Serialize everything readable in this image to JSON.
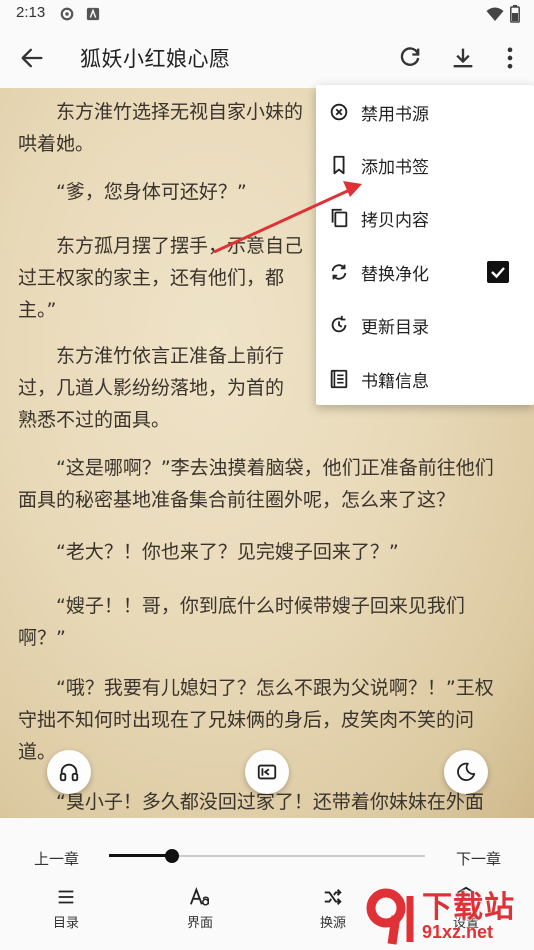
{
  "status": {
    "time": "2:13"
  },
  "appbar": {
    "title": "狐妖小红娘心愿"
  },
  "reader": {
    "paragraphs": [
      "　　东方淮竹选择无视自家小妹的存在，陪笑哄着她。",
      "　　“爹，您身体可还好？”",
      "　　东方孤月摆了摆手，示意自己无碍，又想起了过王权家的家主，还有他们，都是正道中的人士。”",
      "　　东方淮竹依言正准备上前行礼，一阵风吹过，几道人影纷纷落地，为首的人带着熟悉不过的面具。",
      "　　“这是哪啊？”李去浊摸着脑袋，他们正准备前往他们面具的秘密基地准备集合前往圈外呢，怎么来了这？",
      "　　“老大？！你也来了？见完嫂子回来了？”",
      "　　“嫂子！！哥，你到底什么时候带嫂子回来见我们啊？”",
      "　　“哦？我要有儿媳妇了？怎么不跟为父说啊？！”王权守拙不知何时出现在了兄妹俩的身后，皮笑肉不笑的问道。",
      "　　“臭小子！多久都没回过家了！还带着你妹妹在外面"
    ],
    "visible_lines": [
      [
        "　　东方淮竹选择无视自家小妹的",
        "哄着她。"
      ],
      [
        "　　“爹，您身体可还好？”"
      ],
      [
        "　　东方孤月摆了摆手，示意自己",
        "过王权家的家主，还有他们，都",
        "主。”"
      ],
      [
        "　　东方淮竹依言正准备上前行",
        "过，几道人影纷纷落地，为首的",
        "熟悉不过的面具。"
      ],
      [
        "　　“这是哪啊？”李去浊摸着脑袋，他们正准备前往他们",
        "面具的秘密基地准备集合前往圈外呢，怎么来了这？"
      ],
      [
        "　　“老大？！你也来了？见完嫂子回来了？”"
      ],
      [
        "　　“嫂子！！哥，你到底什么时候带嫂子回来见我们",
        "啊？”"
      ],
      [
        "　　“哦？我要有儿媳妇了？怎么不跟为父说啊？！”王权",
        "守拙不知何时出现在了兄妹俩的身后，皮笑肉不笑的问",
        "道。"
      ],
      [
        "　　“臭小子！多久都没回过家了！还带着你妹妹在外面"
      ]
    ]
  },
  "menu": {
    "items": [
      {
        "label": "禁用书源",
        "icon": "block-icon"
      },
      {
        "label": "添加书签",
        "icon": "bookmark-icon"
      },
      {
        "label": "拷贝内容",
        "icon": "copy-icon"
      },
      {
        "label": "替换净化",
        "icon": "replace-icon",
        "checked": true
      },
      {
        "label": "更新目录",
        "icon": "refresh-toc-icon"
      },
      {
        "label": "书籍信息",
        "icon": "book-info-icon"
      }
    ]
  },
  "bottom": {
    "prev_chapter": "上一章",
    "next_chapter": "下一章",
    "progress": 0.2,
    "tabs": [
      {
        "label": "目录",
        "icon": "list-icon"
      },
      {
        "label": "界面",
        "icon": "text-style-icon"
      },
      {
        "label": "换源",
        "icon": "shuffle-icon"
      },
      {
        "label": "设置",
        "icon": "settings-icon"
      }
    ]
  },
  "watermark": {
    "cn": "下载站",
    "url": "91xz.net"
  },
  "colors": {
    "accent": "#111111",
    "paper": "#e8d9b8",
    "annotation": "#e03236"
  }
}
